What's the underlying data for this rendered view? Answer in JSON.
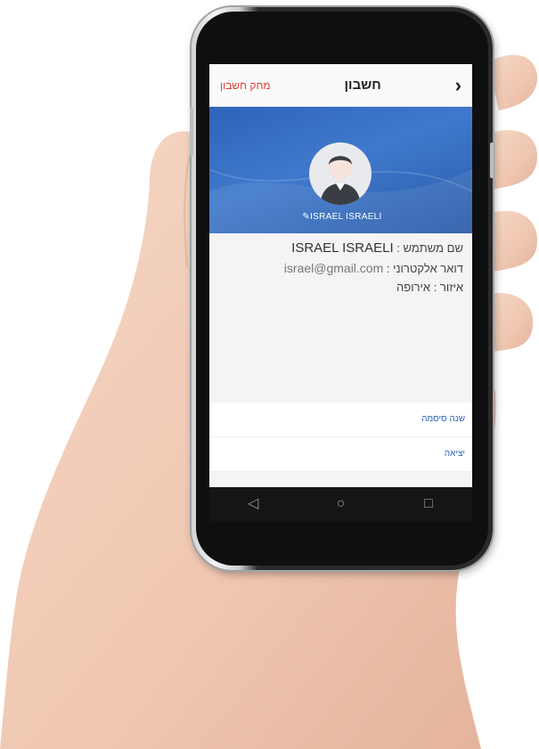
{
  "header": {
    "delete_account": "מחק חשבון",
    "title": "חשבון",
    "back_icon": "chevron-right-icon"
  },
  "profile": {
    "avatar_icon": "user-avatar-icon",
    "edit_icon": "pencil-icon",
    "display_name": "ISRAEL ISRAELI"
  },
  "info": {
    "username_label": "שם משתמש :",
    "username_value": "ISRAEL ISRAELI",
    "email_label": "דואר אלקטרוני :",
    "email_value": "israel@gmail.com",
    "region_label": "איזור :",
    "region_value": "אירופה"
  },
  "actions": {
    "change_password": "שנה סיסמה",
    "logout": "יציאה"
  },
  "android_nav": {
    "back_glyph": "◁",
    "home_glyph": "○",
    "recents_glyph": "□"
  },
  "colors": {
    "accent": "#2f64b8",
    "danger": "#e53935"
  }
}
